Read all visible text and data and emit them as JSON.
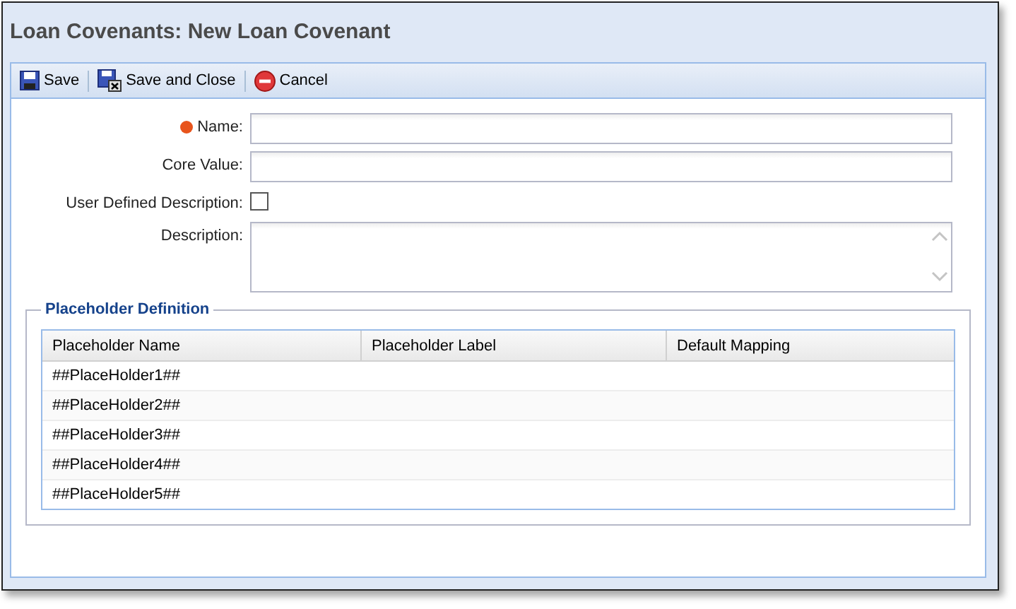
{
  "window": {
    "title": "Loan Covenants: New Loan Covenant"
  },
  "toolbar": [
    {
      "kind": "save",
      "label": "Save"
    },
    {
      "kind": "save-close",
      "label": "Save and Close"
    },
    {
      "kind": "cancel",
      "label": "Cancel"
    }
  ],
  "form": {
    "fields": [
      {
        "kind": "text",
        "label": "Name:",
        "required": true
      },
      {
        "kind": "text",
        "label": "Core Value:",
        "required": false
      },
      {
        "kind": "checkbox",
        "label": "User Defined Description:",
        "required": false,
        "checked": false
      },
      {
        "kind": "textarea",
        "label": "Description:",
        "required": false
      }
    ]
  },
  "placeholder_definition": {
    "title": "Placeholder Definition",
    "table": {
      "columns": [
        "Placeholder Name",
        "Placeholder Label",
        "Default Mapping"
      ],
      "rows": [
        [
          "##PlaceHolder1##",
          "",
          ""
        ],
        [
          "##PlaceHolder2##",
          "",
          ""
        ],
        [
          "##PlaceHolder3##",
          "",
          ""
        ],
        [
          "##PlaceHolder4##",
          "",
          ""
        ],
        [
          "##PlaceHolder5##",
          "",
          ""
        ]
      ]
    }
  }
}
